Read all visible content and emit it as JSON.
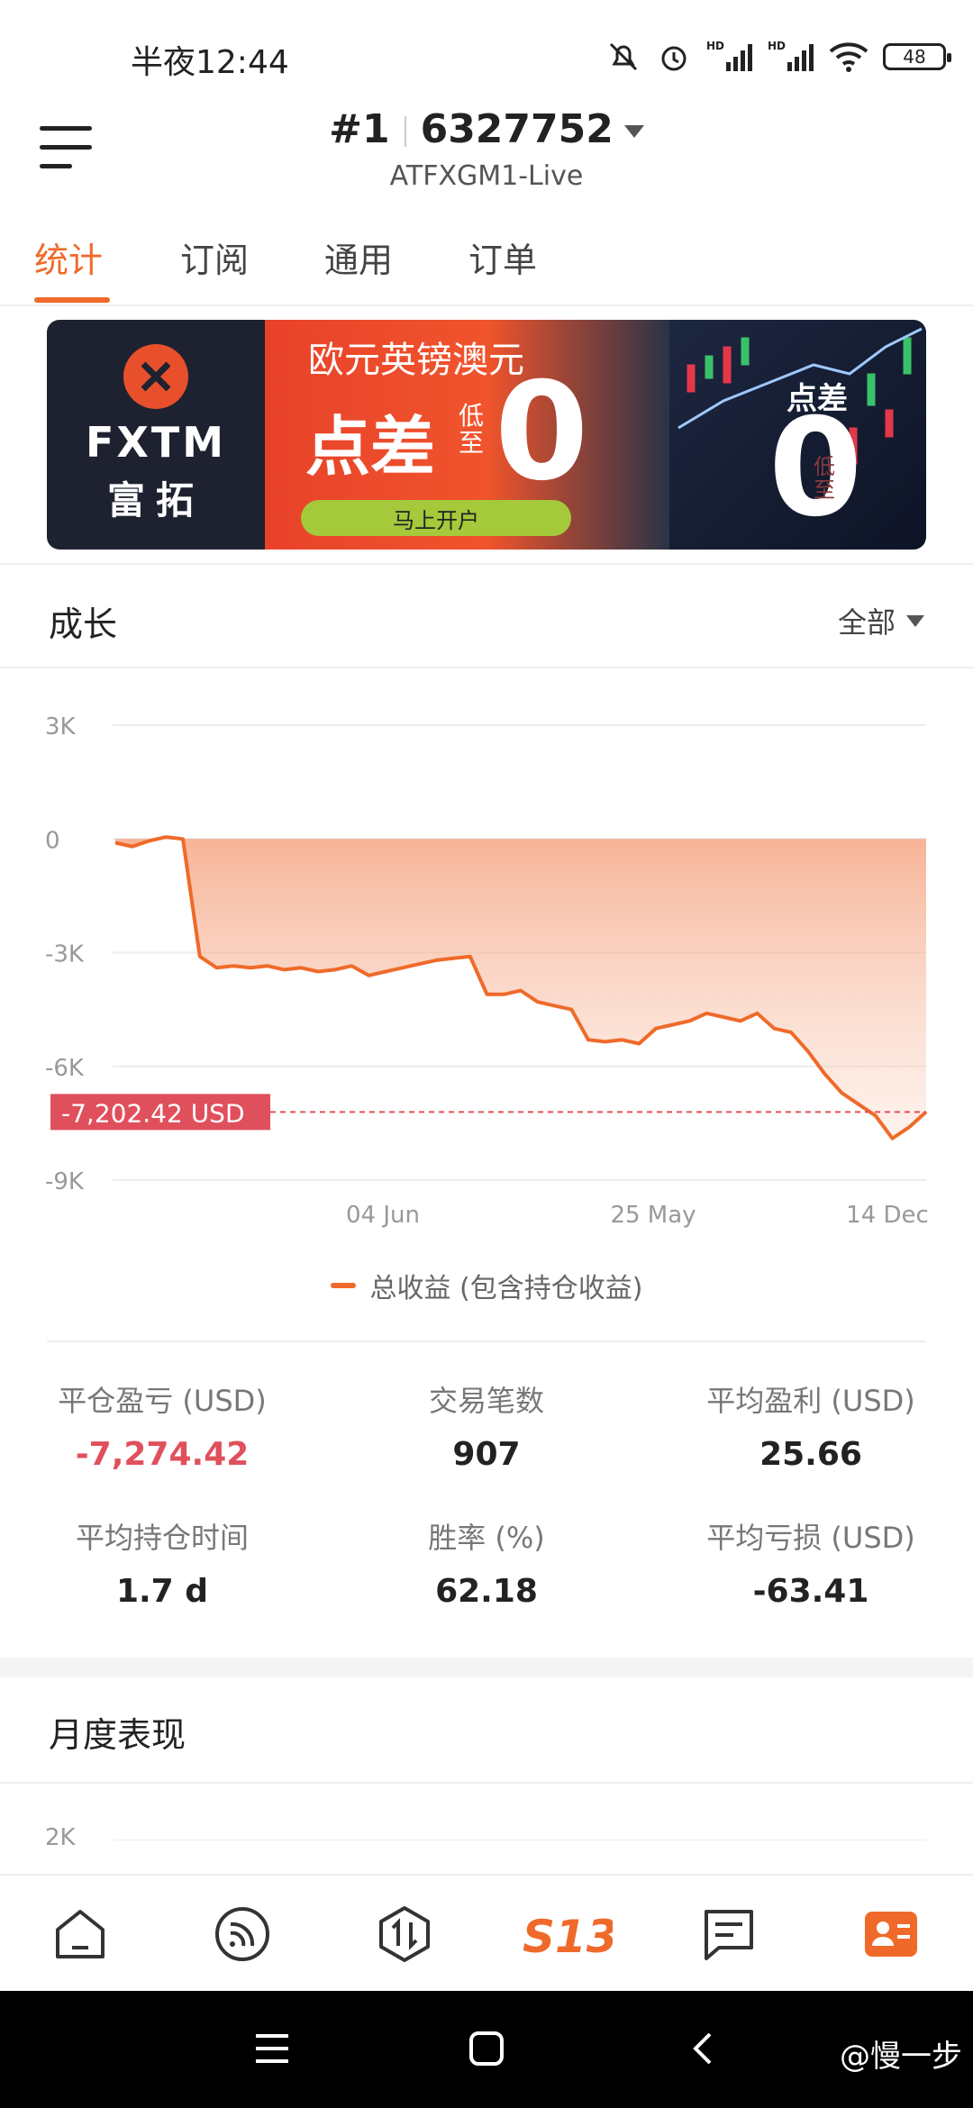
{
  "status_bar": {
    "time": "半夜12:44",
    "battery": "48"
  },
  "header": {
    "account_index": "#1",
    "account_number": "6327752",
    "server": "ATFXGM1-Live"
  },
  "tabs": [
    {
      "label": "统计",
      "active": true
    },
    {
      "label": "订阅",
      "active": false
    },
    {
      "label": "通用",
      "active": false
    },
    {
      "label": "订单",
      "active": false
    }
  ],
  "banner": {
    "brand": "FXTM",
    "brand_cn": "富拓",
    "headline": "欧元英镑澳元",
    "big_text": "点差",
    "low_text": "低至",
    "zero": "0",
    "cta": "马上开户",
    "right_label": "点差",
    "right_zero": "0",
    "right_low": "低至"
  },
  "growth": {
    "title": "成长",
    "range": "全部",
    "legend": "总收益 (包含持仓收益)",
    "marker_label": "-7,202.42 USD"
  },
  "chart_data": {
    "type": "area",
    "title": "成长",
    "yticks": [
      "3K",
      "0",
      "-3K",
      "-6K",
      "-9K"
    ],
    "yvalues": [
      3000,
      0,
      -3000,
      -6000,
      -9000
    ],
    "ylim": [
      -9000,
      3000
    ],
    "xticks": [
      "04 Jun",
      "25 May",
      "14 Dec"
    ],
    "grid": true,
    "reference_line": -7202.42,
    "series": [
      {
        "name": "总收益 (包含持仓收益)",
        "values": [
          -100,
          -200,
          -50,
          50,
          0,
          -3100,
          -3400,
          -3350,
          -3400,
          -3350,
          -3450,
          -3400,
          -3500,
          -3450,
          -3350,
          -3600,
          -3500,
          -3400,
          -3300,
          -3200,
          -3150,
          -3100,
          -4100,
          -4100,
          -4000,
          -4300,
          -4400,
          -4500,
          -5300,
          -5350,
          -5300,
          -5400,
          -5000,
          -4900,
          -4800,
          -4600,
          -4700,
          -4800,
          -4600,
          -5000,
          -5100,
          -5600,
          -6200,
          -6700,
          -7000,
          -7300,
          -7900,
          -7600,
          -7200
        ]
      }
    ]
  },
  "stats": [
    {
      "label": "平仓盈亏 (USD)",
      "value": "-7,274.42",
      "negative": true
    },
    {
      "label": "交易笔数",
      "value": "907",
      "negative": false
    },
    {
      "label": "平均盈利 (USD)",
      "value": "25.66",
      "negative": false
    },
    {
      "label": "平均持仓时间",
      "value": "1.7 d",
      "negative": false
    },
    {
      "label": "胜率 (%)",
      "value": "62.18",
      "negative": false
    },
    {
      "label": "平均亏损 (USD)",
      "value": "-63.41",
      "negative": false
    }
  ],
  "monthly": {
    "title": "月度表现",
    "first_tick": "2K"
  },
  "watermark": "@慢一步",
  "colors": {
    "accent": "#ef6a2a",
    "negative": "#e0505c"
  }
}
